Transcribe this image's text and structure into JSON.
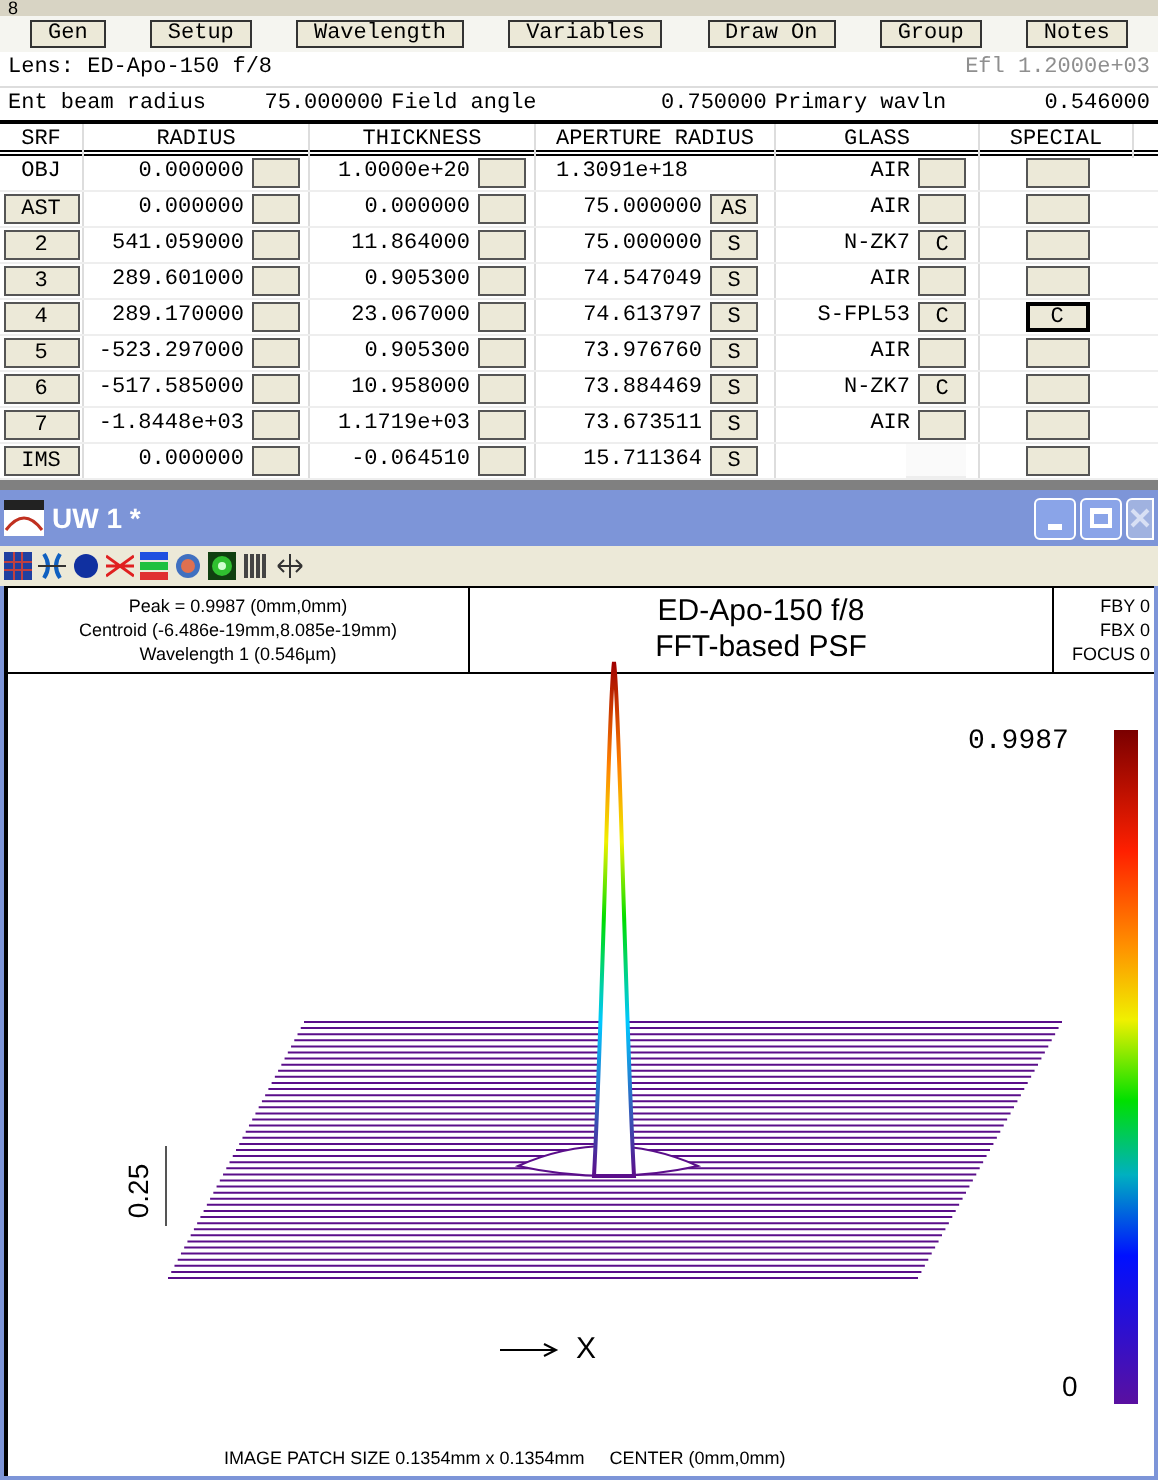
{
  "title_fragment": "8",
  "toolbar": [
    "Gen",
    "Setup",
    "Wavelength",
    "Variables",
    "Draw On",
    "Group",
    "Notes"
  ],
  "lens": {
    "label": "Lens: ED-Apo-150 f/8",
    "efl": "Efl  1.2000e+03",
    "efl_disabled": true
  },
  "system": [
    {
      "label": "Ent beam radius",
      "value": "75.000000"
    },
    {
      "label": "Field angle",
      "value": "0.750000"
    },
    {
      "label": "Primary wavln",
      "value": "0.546000"
    }
  ],
  "columns": [
    "SRF",
    "RADIUS",
    "THICKNESS",
    "APERTURE RADIUS",
    "GLASS",
    "SPECIAL"
  ],
  "rows": [
    {
      "kind": "label",
      "srf": "OBJ",
      "radius": "0.000000",
      "thickness": "1.0000e+20",
      "aperture": "1.3091e+18",
      "glass": "AIR",
      "glass_button": true,
      "special_focused": false
    },
    {
      "kind": "button",
      "srf": "AST",
      "radius": "0.000000",
      "thickness": "0.000000",
      "aperture": "75.000000",
      "aperture_solve": "AS",
      "glass": "AIR",
      "glass_button": true,
      "special_focused": false
    },
    {
      "kind": "button",
      "srf": "2",
      "radius": "541.059000",
      "thickness": "11.864000",
      "aperture": "75.000000",
      "aperture_solve": "S",
      "glass": "N-ZK7",
      "glass_button": true,
      "glass_solve": "C",
      "special_focused": false
    },
    {
      "kind": "button",
      "srf": "3",
      "radius": "289.601000",
      "thickness": "0.905300",
      "aperture": "74.547049",
      "aperture_solve": "S",
      "glass": "AIR",
      "glass_button": true,
      "special_focused": false
    },
    {
      "kind": "button",
      "srf": "4",
      "radius": "289.170000",
      "thickness": "23.067000",
      "aperture": "74.613797",
      "aperture_solve": "S",
      "glass": "S-FPL53",
      "glass_button": true,
      "glass_solve": "C",
      "special": "C",
      "special_focused": true
    },
    {
      "kind": "button",
      "srf": "5",
      "radius": "-523.297000",
      "thickness": "0.905300",
      "aperture": "73.976760",
      "aperture_solve": "S",
      "glass": "AIR",
      "glass_button": true,
      "special_focused": false
    },
    {
      "kind": "button",
      "srf": "6",
      "radius": "-517.585000",
      "thickness": "10.958000",
      "aperture": "73.884469",
      "aperture_solve": "S",
      "glass": "N-ZK7",
      "glass_button": true,
      "glass_solve": "C",
      "special_focused": false
    },
    {
      "kind": "button",
      "srf": "7",
      "radius": "-1.8448e+03",
      "thickness": "1.1719e+03",
      "aperture": "73.673511",
      "aperture_solve": "S",
      "glass": "AIR",
      "glass_button": true,
      "special_focused": false
    },
    {
      "kind": "button",
      "srf": "IMS",
      "radius": "0.000000",
      "thickness": "-0.064510",
      "aperture": "15.711364",
      "aperture_solve": "S",
      "glass_button": false,
      "special_focused": false
    }
  ],
  "window": {
    "title": "UW 1 *",
    "close_disabled": true
  },
  "plot_header": {
    "info": [
      "Peak = 0.9987 (0mm,0mm)",
      "Centroid (-6.486e-19mm,8.085e-19mm)",
      "Wavelength 1 (0.546µm)"
    ],
    "title": [
      "ED-Apo-150 f/8",
      "FFT-based PSF"
    ],
    "params": [
      "FBY 0",
      "FBX 0",
      "FOCUS 0"
    ]
  },
  "plot": {
    "max_label": "0.9987",
    "min_label": "0",
    "y_tick": "0.25",
    "x_axis": "X",
    "footer": "IMAGE PATCH SIZE 0.1354mm x 0.1354mm     CENTER (0mm,0mm)"
  }
}
